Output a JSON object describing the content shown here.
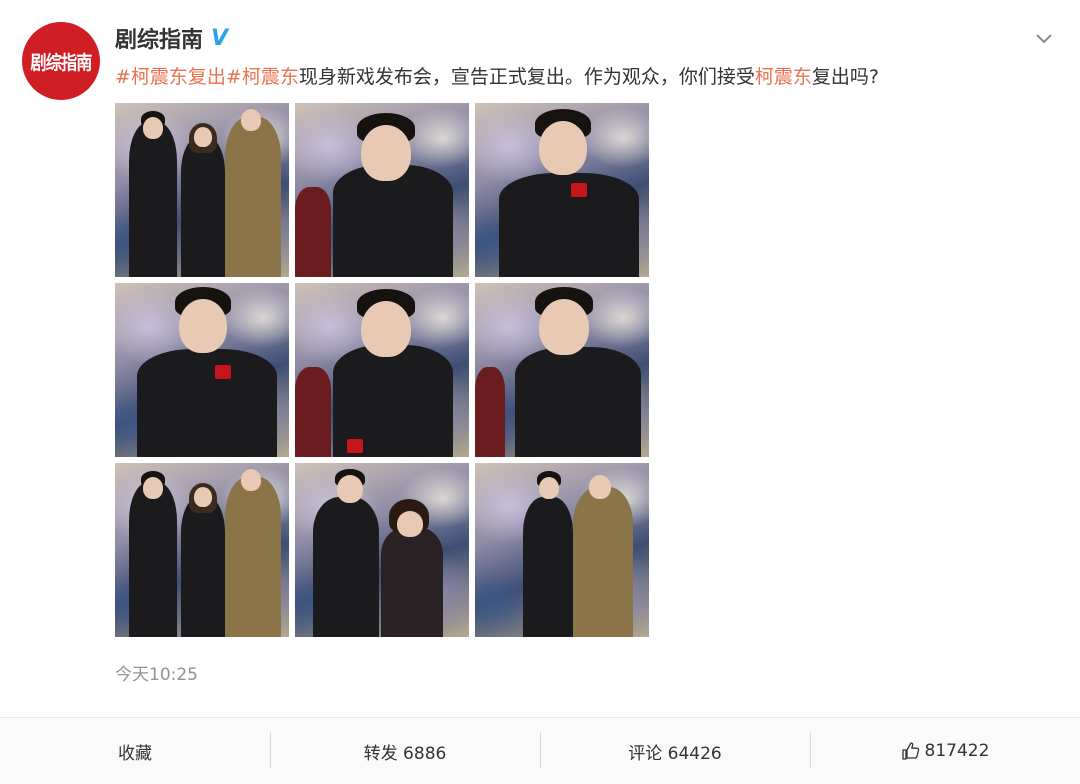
{
  "account": {
    "avatar_text": "剧综指南",
    "name": "剧综指南",
    "verified_mark": "V"
  },
  "post": {
    "segments": [
      {
        "text": "#柯震东复出#",
        "type": "tag"
      },
      {
        "text": "柯震东",
        "type": "tag"
      },
      {
        "text": "现身新戏发布会，宣告正式复出。作为观众，你们接受",
        "type": "text"
      },
      {
        "text": "柯震东",
        "type": "tag"
      },
      {
        "text": "复出吗?",
        "type": "text"
      }
    ],
    "image_count": 9,
    "timestamp": "今天10:25"
  },
  "actions": {
    "favorite_label": "收藏",
    "repost_label": "转发 6886",
    "comment_label": "评论 64426",
    "like_count": "817422"
  },
  "colors": {
    "brand_red": "#cf1f25",
    "tag_color": "#eb7350",
    "verified_blue": "#2ba3e8"
  },
  "icons": {
    "more": "chevron-down-icon",
    "like": "thumbs-up-icon"
  }
}
